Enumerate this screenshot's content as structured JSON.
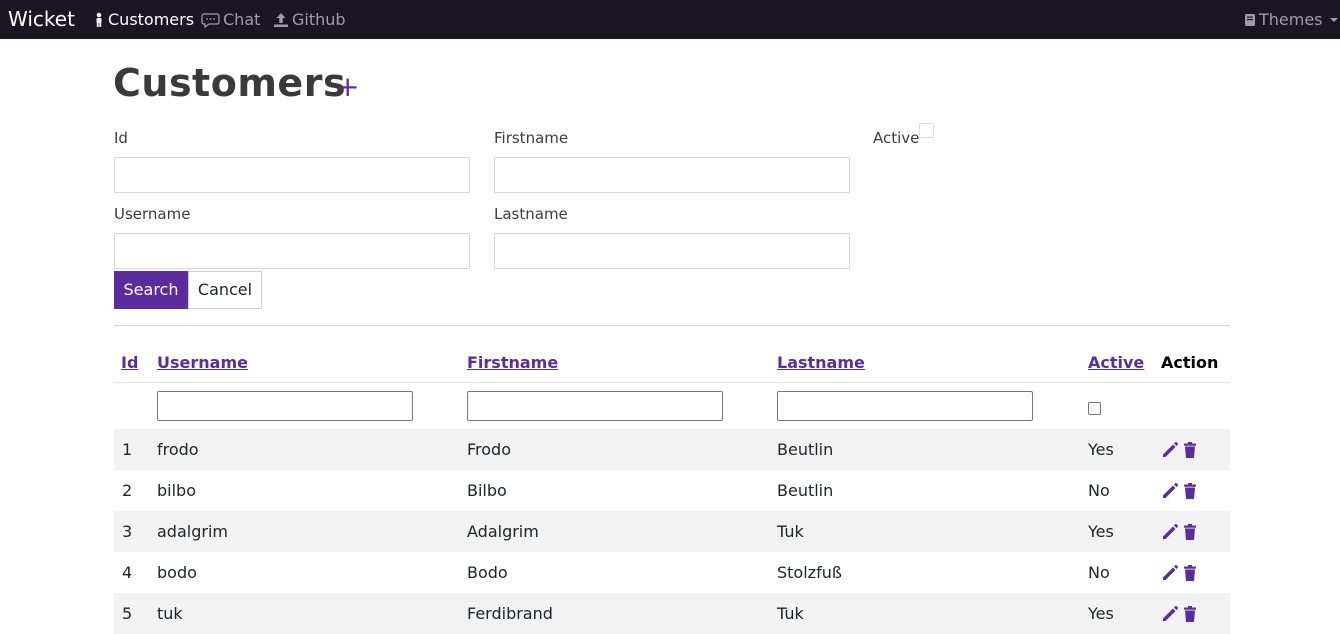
{
  "navbar": {
    "brand": "Wicket",
    "items": [
      {
        "label": "Customers",
        "icon": "person-icon",
        "active": true
      },
      {
        "label": "Chat",
        "icon": "chat-icon",
        "active": false
      },
      {
        "label": "Github",
        "icon": "upload-icon",
        "active": false
      }
    ],
    "themes_label": "Themes"
  },
  "page": {
    "title": "Customers",
    "add_label": "+"
  },
  "search_form": {
    "id_label": "Id",
    "firstname_label": "Firstname",
    "active_label": "Active",
    "username_label": "Username",
    "lastname_label": "Lastname",
    "id_value": "",
    "firstname_value": "",
    "username_value": "",
    "lastname_value": "",
    "active_checked": false,
    "search_button": "Search",
    "cancel_button": "Cancel"
  },
  "table": {
    "columns": [
      "Id",
      "Username",
      "Firstname",
      "Lastname",
      "Active",
      "Action"
    ],
    "rows": [
      {
        "id": "1",
        "username": "frodo",
        "firstname": "Frodo",
        "lastname": "Beutlin",
        "active": "Yes"
      },
      {
        "id": "2",
        "username": "bilbo",
        "firstname": "Bilbo",
        "lastname": "Beutlin",
        "active": "No"
      },
      {
        "id": "3",
        "username": "adalgrim",
        "firstname": "Adalgrim",
        "lastname": "Tuk",
        "active": "Yes"
      },
      {
        "id": "4",
        "username": "bodo",
        "firstname": "Bodo",
        "lastname": "Stolzfuß",
        "active": "No"
      },
      {
        "id": "5",
        "username": "tuk",
        "firstname": "Ferdibrand",
        "lastname": "Tuk",
        "active": "Yes"
      }
    ]
  },
  "colors": {
    "accent": "#5b2c9e",
    "navbar_bg": "#1a1624",
    "stripe": "#f2f2f2"
  }
}
